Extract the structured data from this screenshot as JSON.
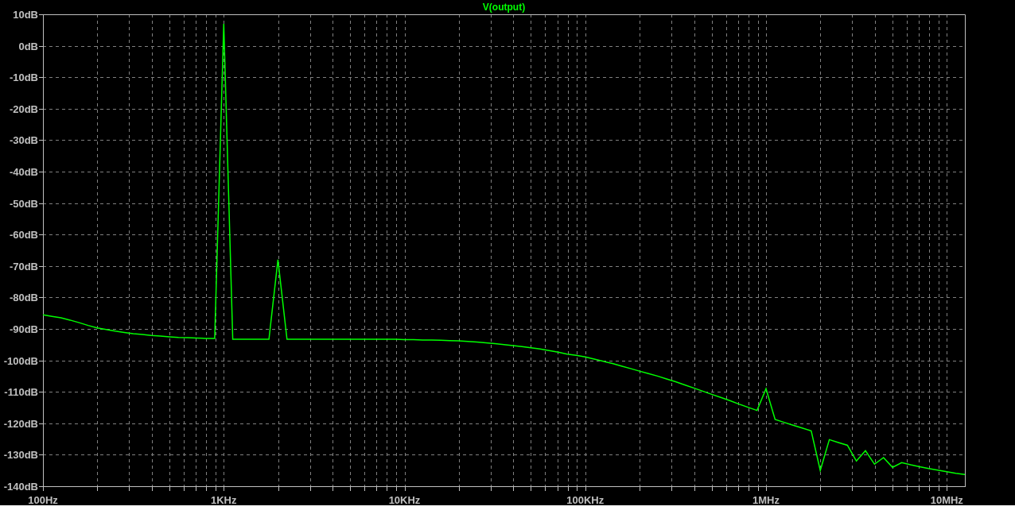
{
  "plot": {
    "chart_data": {
      "type": "line",
      "grid": true,
      "ylim": [
        -140,
        10
      ],
      "categories": [
        "100Hz",
        null,
        null,
        null,
        null,
        null,
        null,
        null,
        null,
        null,
        null,
        null,
        null,
        null,
        null,
        null,
        null,
        null,
        null,
        null,
        "1KHz",
        null,
        null,
        null,
        null,
        null,
        null,
        null,
        null,
        null,
        null,
        null,
        null,
        null,
        null,
        null,
        null,
        null,
        null,
        null,
        "10KHz",
        null,
        null,
        null,
        null,
        null,
        null,
        null,
        null,
        null,
        null,
        null,
        null,
        null,
        null,
        null,
        null,
        null,
        null,
        null,
        "100KHz",
        null,
        null,
        null,
        null,
        null,
        null,
        null,
        null,
        null,
        null,
        null,
        null,
        null,
        null,
        null,
        null,
        null,
        null,
        null,
        "1MHz",
        null,
        null,
        null,
        null,
        null,
        null,
        null,
        null,
        null,
        null,
        null,
        null,
        null,
        null,
        null,
        null,
        null,
        null,
        null,
        "10MHz",
        null,
        null
      ],
      "yticks": [
        {
          "value": 10,
          "label": "10dB"
        },
        {
          "value": 0,
          "label": "0dB"
        },
        {
          "value": -10,
          "label": "-10dB"
        },
        {
          "value": -20,
          "label": "-20dB"
        },
        {
          "value": -30,
          "label": "-30dB"
        },
        {
          "value": -40,
          "label": "-40dB"
        },
        {
          "value": -50,
          "label": "-50dB"
        },
        {
          "value": -60,
          "label": "-60dB"
        },
        {
          "value": -70,
          "label": "-70dB"
        },
        {
          "value": -80,
          "label": "-80dB"
        },
        {
          "value": -90,
          "label": "-90dB"
        },
        {
          "value": -100,
          "label": "-100dB"
        },
        {
          "value": -110,
          "label": "-110dB"
        },
        {
          "value": -120,
          "label": "-120dB"
        },
        {
          "value": -130,
          "label": "-130dB"
        },
        {
          "value": -140,
          "label": "-140dB"
        }
      ],
      "series": [
        {
          "name": "V(output)",
          "color": "#00ff00",
          "values": [
            -85.5,
            -86,
            -86.5,
            -87.2,
            -88,
            -88.9,
            -89.7,
            -90.2,
            -90.7,
            -91.1,
            -91.5,
            -91.8,
            -92.1,
            -92.3,
            -92.5,
            -92.7,
            -92.8,
            -92.9,
            -93,
            -93,
            7,
            -93.3,
            -93.3,
            -93.3,
            -93.3,
            -93.3,
            -68,
            -93.3,
            -93.3,
            -93.3,
            -93.3,
            -93.3,
            -93.3,
            -93.3,
            -93.3,
            -93.3,
            -93.3,
            -93.3,
            -93.3,
            -93.3,
            -93.4,
            -93.4,
            -93.5,
            -93.5,
            -93.6,
            -93.7,
            -93.8,
            -94,
            -94.2,
            -94.4,
            -94.7,
            -95,
            -95.3,
            -95.6,
            -96,
            -96.4,
            -96.9,
            -97.4,
            -98,
            -98.4,
            -98.9,
            -99.6,
            -100.3,
            -101,
            -101.8,
            -102.6,
            -103.4,
            -104.2,
            -105,
            -105.9,
            -106.8,
            -107.8,
            -108.8,
            -109.8,
            -110.8,
            -111.8,
            -112.8,
            -113.9,
            -114.9,
            -115.9,
            -109,
            -118.8,
            -119.7,
            -120.6,
            -121.5,
            -122.4,
            -135,
            -125.2,
            -126.1,
            -127,
            -132,
            -128.7,
            -133,
            -130.9,
            -134,
            -132.5,
            -133.2,
            -133.8,
            -134.4,
            -134.9,
            -135.4,
            -135.9,
            -136.3
          ]
        }
      ]
    }
  }
}
